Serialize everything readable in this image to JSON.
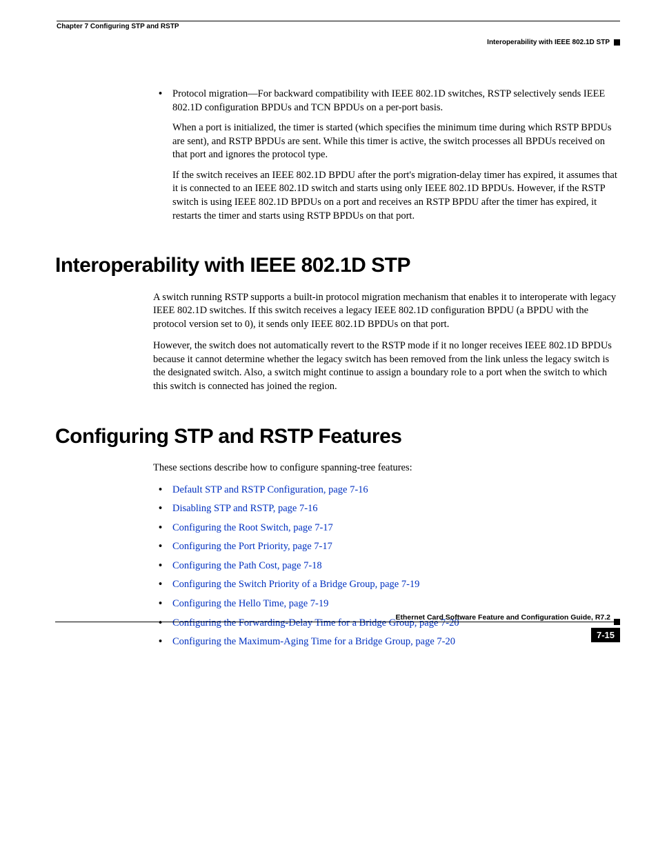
{
  "header": {
    "chapter": "Chapter 7 Configuring STP and RSTP",
    "section_right": "Interoperability with IEEE 802.1D STP"
  },
  "top_bullet": {
    "lead": "Protocol migration—For backward compatibility with IEEE 802.1D switches, RSTP selectively sends IEEE 802.1D configuration BPDUs and TCN BPDUs on a per-port basis.",
    "para2": "When a port is initialized, the timer is started (which specifies the minimum time during which RSTP BPDUs are sent), and RSTP BPDUs are sent. While this timer is active, the switch processes all BPDUs received on that port and ignores the protocol type.",
    "para3": "If the switch receives an IEEE 802.1D BPDU after the port's migration-delay timer has expired, it assumes that it is connected to an IEEE 802.1D switch and starts using only IEEE 802.1D BPDUs. However, if the RSTP switch is using IEEE 802.1D BPDUs on a port and receives an RSTP BPDU after the timer has expired, it restarts the timer and starts using RSTP BPDUs on that port."
  },
  "interop": {
    "heading": "Interoperability with IEEE 802.1D STP",
    "p1": "A switch running RSTP supports a built-in protocol migration mechanism that enables it to interoperate with legacy IEEE 802.1D switches. If this switch receives a legacy IEEE 802.1D configuration BPDU (a BPDU with the protocol version set to 0), it sends only IEEE 802.1D BPDUs on that port.",
    "p2": "However, the switch does not automatically revert to the RSTP mode if it no longer receives IEEE 802.1D BPDUs because it cannot determine whether the legacy switch has been removed from the link unless the legacy switch is the designated switch. Also, a switch might continue to assign a boundary role to a port when the switch to which this switch is connected has joined the region."
  },
  "config": {
    "heading": "Configuring STP and RSTP Features",
    "intro": "These sections describe how to configure spanning-tree features:",
    "links": [
      "Default STP and RSTP Configuration, page 7-16",
      "Disabling STP and RSTP, page 7-16",
      "Configuring the Root Switch, page 7-17",
      "Configuring the Port Priority, page 7-17",
      "Configuring the Path Cost, page 7-18",
      "Configuring the Switch Priority of a Bridge Group, page 7-19",
      "Configuring the Hello Time, page 7-19",
      "Configuring the Forwarding-Delay Time for a Bridge Group, page 7-20",
      "Configuring the Maximum-Aging Time for a Bridge Group, page 7-20"
    ]
  },
  "footer": {
    "title": "Ethernet Card Software Feature and Configuration Guide, R7.2",
    "page": "7-15"
  }
}
